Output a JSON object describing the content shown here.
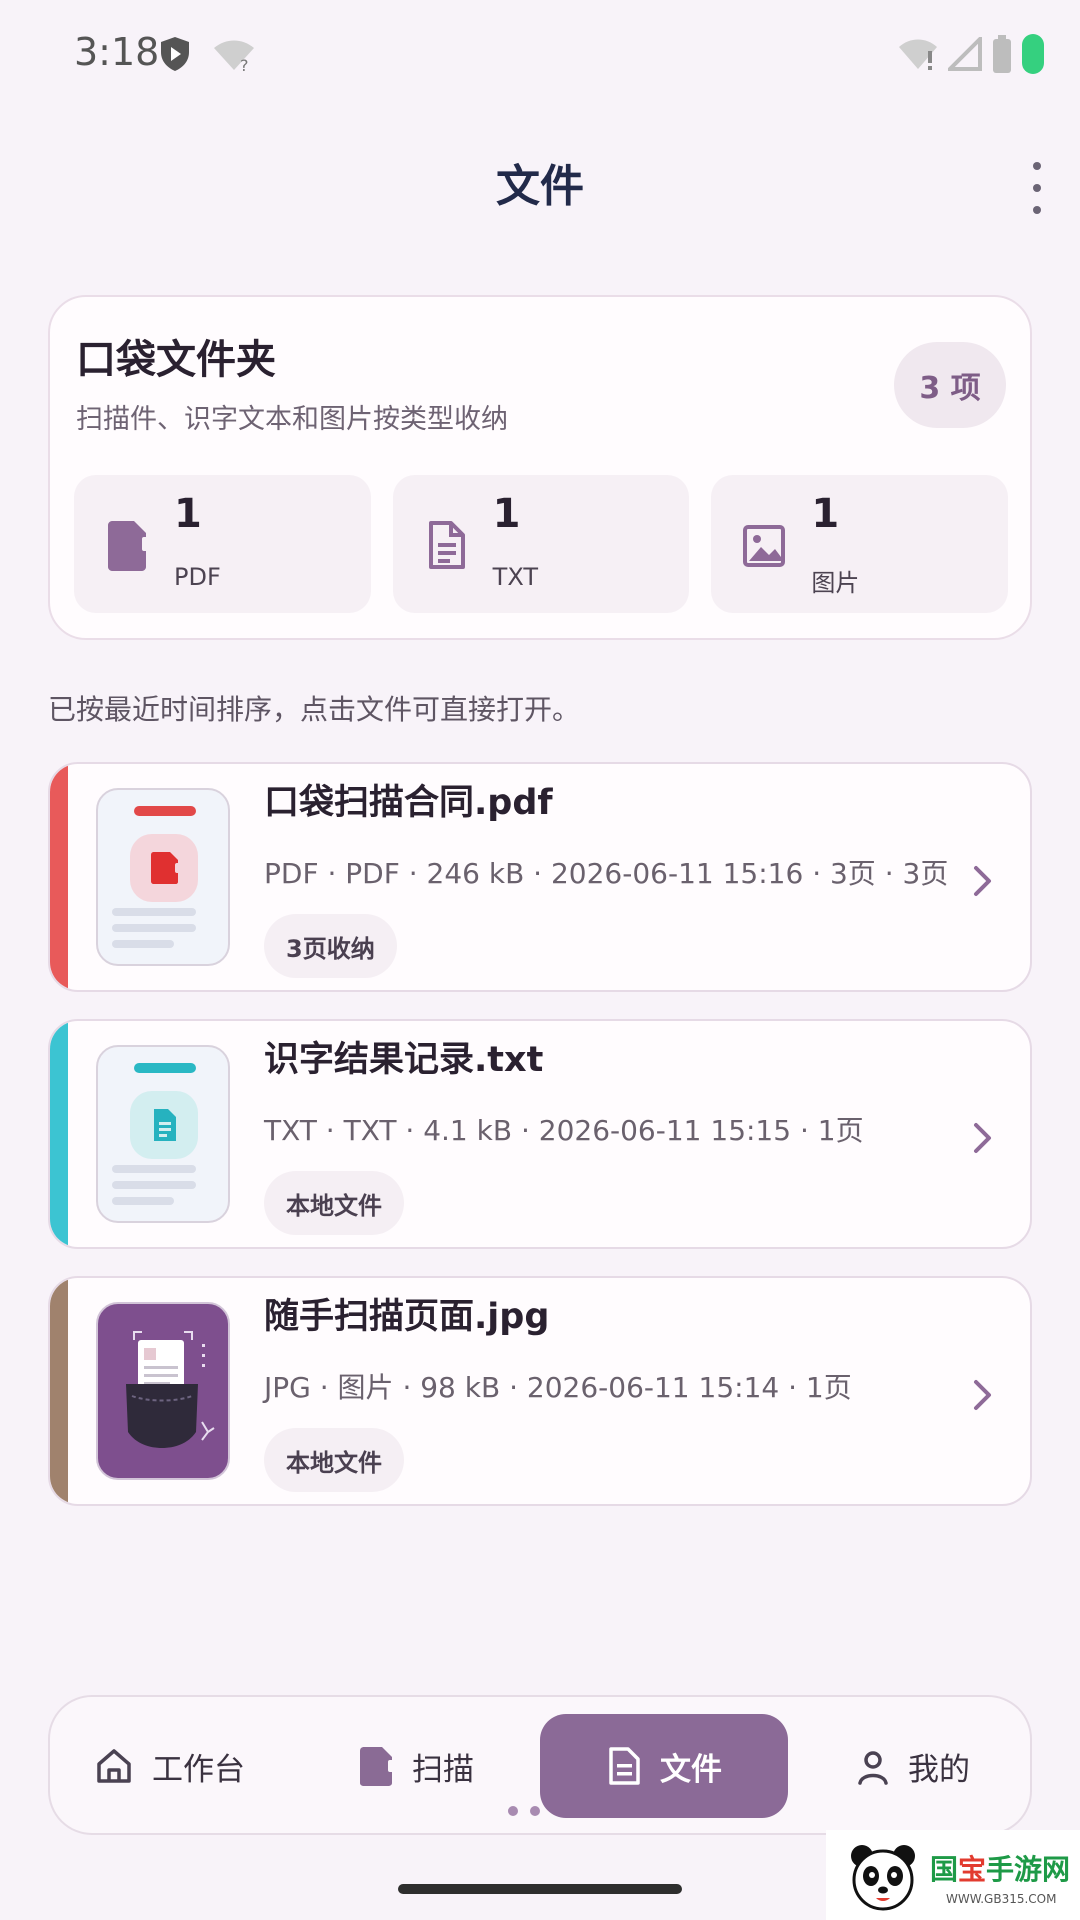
{
  "status_bar": {
    "time": "3:18"
  },
  "header": {
    "title": "文件"
  },
  "summary": {
    "title": "口袋文件夹",
    "subtitle": "扫描件、识字文本和图片按类型收纳",
    "count_badge": "3 项",
    "stats": [
      {
        "count": "1",
        "label": "PDF",
        "icon": "pdf-icon"
      },
      {
        "count": "1",
        "label": "TXT",
        "icon": "text-document-icon"
      },
      {
        "count": "1",
        "label": "图片",
        "icon": "image-icon"
      }
    ]
  },
  "sort_hint": "已按最近时间排序，点击文件可直接打开。",
  "files": [
    {
      "name": "口袋扫描合同.pdf",
      "meta": "PDF · PDF · 246 kB · 2026-06-11 15:16 · 3页 · 3页",
      "tag": "3页收纳",
      "accent": "#e85a5a",
      "icon": "pdf-icon"
    },
    {
      "name": "识字结果记录.txt",
      "meta": "TXT · TXT · 4.1 kB · 2026-06-11 15:15 · 1页",
      "tag": "本地文件",
      "accent": "#3cc4d2",
      "icon": "text-document-icon"
    },
    {
      "name": "随手扫描页面.jpg",
      "meta": "JPG · 图片 · 98 kB · 2026-06-11 15:14 · 1页",
      "tag": "本地文件",
      "accent": "#a0826d",
      "icon": "pocket-scan-thumbnail"
    }
  ],
  "bottom_nav": {
    "items": [
      {
        "label": "工作台",
        "icon": "home-icon"
      },
      {
        "label": "扫描",
        "icon": "scan-icon"
      },
      {
        "label": "文件",
        "icon": "file-icon",
        "active": true
      },
      {
        "label": "我的",
        "icon": "person-icon"
      }
    ]
  },
  "watermark": {
    "brand_green": "国",
    "brand_red": "宝",
    "brand_rest": "手游网",
    "url": "WWW.GB315.COM"
  },
  "colors": {
    "primary": "#8b6a97",
    "background": "#f8f3f9"
  }
}
